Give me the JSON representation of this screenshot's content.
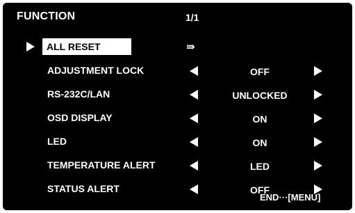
{
  "menu": {
    "title": "FUNCTION",
    "page": "1/1",
    "submenu_arrow": "⇛",
    "items": [
      {
        "label": "ALL RESET",
        "selected": true
      },
      {
        "label": "ADJUSTMENT LOCK",
        "value": "OFF"
      },
      {
        "label": "RS-232C/LAN",
        "value": "UNLOCKED"
      },
      {
        "label": "OSD DISPLAY",
        "value": "ON"
      },
      {
        "label": "LED",
        "value": "ON"
      },
      {
        "label": "TEMPERATURE ALERT",
        "value": "LED"
      },
      {
        "label": "STATUS ALERT",
        "value": "OFF"
      }
    ]
  },
  "footer": {
    "end_hint": "END···[MENU]"
  },
  "colors": {
    "background": "#000000",
    "text": "#ffffff",
    "highlight": "#ffffff"
  }
}
